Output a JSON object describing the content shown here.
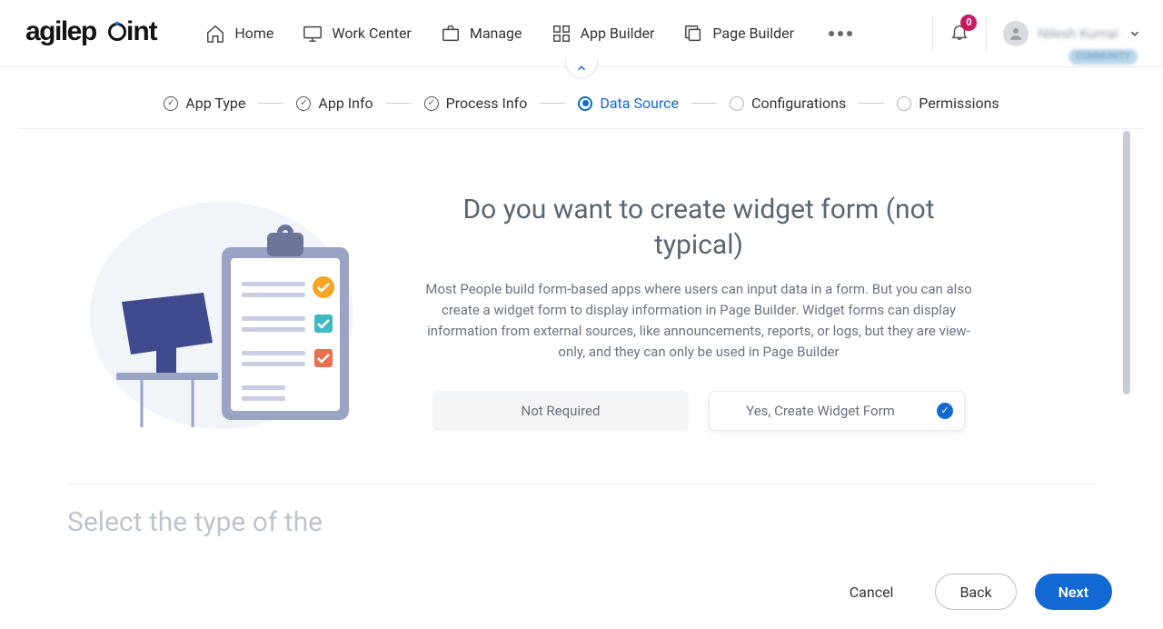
{
  "brand": "agilepoint",
  "nav": {
    "home": "Home",
    "workCenter": "Work Center",
    "manage": "Manage",
    "appBuilder": "App Builder",
    "pageBuilder": "Page Builder"
  },
  "notifications": {
    "count": "0"
  },
  "user": {
    "name": "Nilesh Kumar",
    "tag": "COMMUNITY"
  },
  "wizard": {
    "steps": [
      {
        "label": "App Type",
        "state": "completed"
      },
      {
        "label": "App Info",
        "state": "completed"
      },
      {
        "label": "Process Info",
        "state": "completed"
      },
      {
        "label": "Data Source",
        "state": "active"
      },
      {
        "label": "Configurations",
        "state": "pending"
      },
      {
        "label": "Permissions",
        "state": "pending"
      }
    ]
  },
  "section": {
    "title": "Do you want to create widget form (not typical)",
    "description": "Most People build form-based apps where users can input data in a form. But you can also create a widget form to display information in Page Builder. Widget forms can display information from external sources, like announcements, reports, or logs, but they are view-only, and they can only be used in Page Builder",
    "options": {
      "notRequired": "Not Required",
      "yes": "Yes, Create Widget Form"
    }
  },
  "nextSection": {
    "titlePartial": "Select the type of the"
  },
  "footer": {
    "cancel": "Cancel",
    "back": "Back",
    "next": "Next"
  }
}
